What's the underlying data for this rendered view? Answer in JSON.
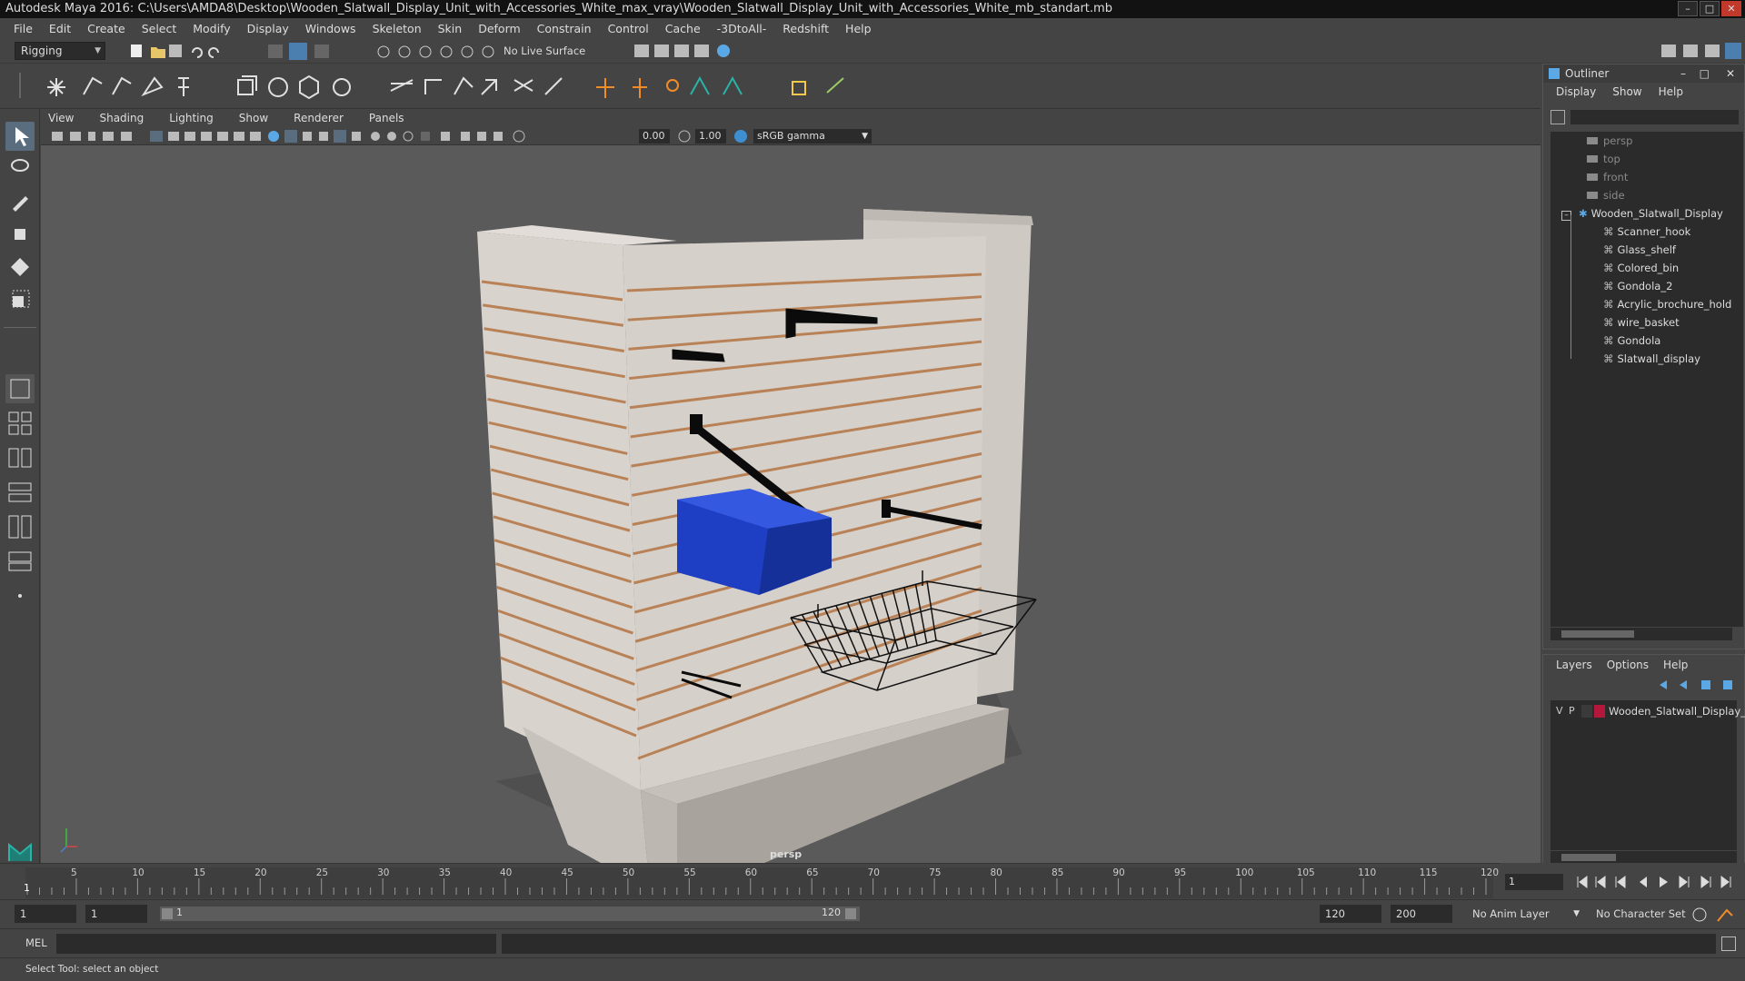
{
  "window": {
    "title": "Autodesk Maya 2016: C:\\Users\\AMDA8\\Desktop\\Wooden_Slatwall_Display_Unit_with_Accessories_White_max_vray\\Wooden_Slatwall_Display_Unit_with_Accessories_White_mb_standart.mb",
    "min": "–",
    "max": "□",
    "close": "✕"
  },
  "menubar": [
    "File",
    "Edit",
    "Create",
    "Select",
    "Modify",
    "Display",
    "Windows",
    "Skeleton",
    "Skin",
    "Deform",
    "Constrain",
    "Control",
    "Cache",
    "-3DtoAll-",
    "Redshift",
    "Help"
  ],
  "statusline": {
    "mode": "Rigging",
    "live_surface": "No Live Surface"
  },
  "viewport": {
    "menus": [
      "View",
      "Shading",
      "Lighting",
      "Show",
      "Renderer",
      "Panels"
    ],
    "near": "0.00",
    "far": "1.00",
    "color_space": "sRGB gamma",
    "camera_label": "persp"
  },
  "outliner": {
    "title": "Outliner",
    "menus": [
      "Display",
      "Show",
      "Help"
    ],
    "cameras": [
      "persp",
      "top",
      "front",
      "side"
    ],
    "root": "Wooden_Slatwall_Display",
    "children": [
      "Scanner_hook",
      "Glass_shelf",
      "Colored_bin",
      "Gondola_2",
      "Acrylic_brochure_hold",
      "wire_basket",
      "Gondola",
      "Slatwall_display"
    ]
  },
  "layers": {
    "menus": [
      "Layers",
      "Options",
      "Help"
    ],
    "row": {
      "v": "V",
      "p": "P",
      "name": "Wooden_Slatwall_Display_U",
      "color": "#b3173a"
    }
  },
  "timeline": {
    "ticks": [
      "5",
      "10",
      "15",
      "20",
      "25",
      "30",
      "35",
      "40",
      "45",
      "50",
      "55",
      "60",
      "65",
      "70",
      "75",
      "80",
      "85",
      "90",
      "95",
      "100",
      "105",
      "110",
      "115",
      "120"
    ],
    "start_tick": "1",
    "current_frame": "1"
  },
  "range": {
    "start": "1",
    "current": "1",
    "slider_start": "1",
    "slider_end": "120",
    "end": "120",
    "max": "200",
    "anim_layer": "No Anim Layer",
    "char_set": "No Character Set"
  },
  "cmdline": {
    "lang": "MEL"
  },
  "helpline": {
    "text": "Select Tool: select an object"
  },
  "colors": {
    "accent": "#5aa9e6",
    "bin_blue": "#1e3fc4",
    "wood_stripe": "#b98256",
    "panel": "#cfc9c4"
  }
}
